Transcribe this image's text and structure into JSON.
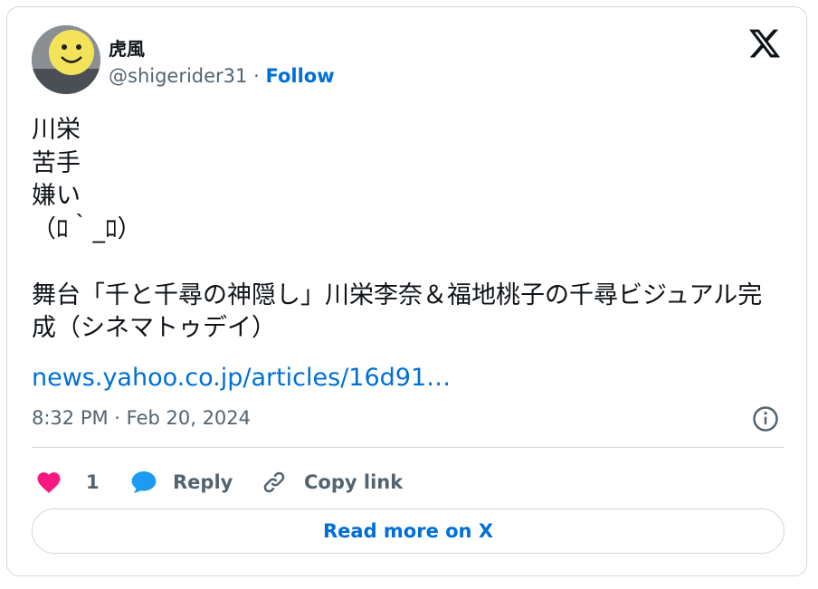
{
  "author": {
    "name": "虎風",
    "handle": "@shigerider31",
    "separator": " · ",
    "follow_label": "Follow"
  },
  "tweet": {
    "text": "川栄\n苦手\n嫌い\n（ﾛ｀_ﾛ）\n\n舞台「千と千尋の神隠し」川栄李奈＆福地桃子の千尋ビジュアル完成（シネマトゥデイ）",
    "link_text": "news.yahoo.co.jp/articles/16d91…",
    "timestamp": "8:32 PM · Feb 20, 2024"
  },
  "actions": {
    "like_count": "1",
    "reply_label": "Reply",
    "copy_label": "Copy link"
  },
  "read_more_label": "Read more on X",
  "icons": {
    "brand": "x-logo-icon",
    "info": "info-icon",
    "like": "heart-icon",
    "reply": "speech-bubble-icon",
    "copy": "link-icon"
  },
  "colors": {
    "accent": "#006fd6",
    "like": "#f91880",
    "reply": "#1d9bf0",
    "muted": "#536471",
    "border": "#cfd9de"
  }
}
